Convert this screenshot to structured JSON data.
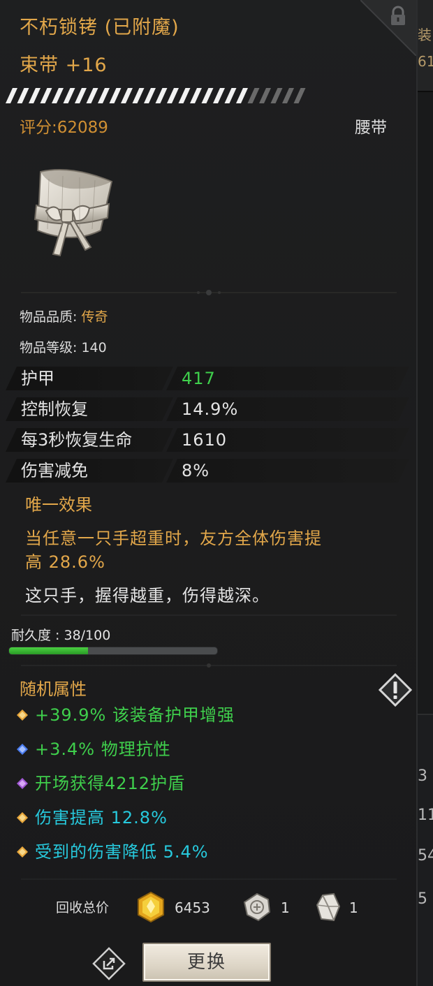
{
  "item": {
    "name": "不朽锁铐 (已附魔)",
    "subtitle": "束带 +16",
    "score": "评分:62089",
    "slot": "腰带",
    "image_icon": "cloth-belt-icon"
  },
  "info": {
    "quality_label": "物品品质: ",
    "quality_value": "传奇",
    "level_label": "物品等级: 140"
  },
  "stats": [
    {
      "name": "护甲",
      "value": "417",
      "color": "#3fcf4c"
    },
    {
      "name": "控制恢复",
      "value": "14.9%",
      "color": "#e4e4e4"
    },
    {
      "name": "每3秒恢复生命",
      "value": "1610",
      "color": "#e4e4e4"
    },
    {
      "name": "伤害减免",
      "value": "8%",
      "color": "#e4e4e4"
    }
  ],
  "unique": {
    "header": "唯一效果",
    "effect_line1": "当任意一只手超重时，友方全体伤害提",
    "effect_line2": "高 28.6%",
    "flavor": "这只手，握得越重，伤得越深。"
  },
  "durability": {
    "label": "耐久度 : 38/100",
    "current": 38,
    "max": 100
  },
  "random_attributes": {
    "header": "随机属性",
    "items": [
      {
        "text": "+39.9% 该装备护甲增强",
        "color": "#3fcf4c",
        "gem": "orange-gem-icon",
        "gem_color": "#e7a63a"
      },
      {
        "text": "+3.4% 物理抗性",
        "color": "#3fcf4c",
        "gem": "blue-gem-icon",
        "gem_color": "#4a7cf0"
      },
      {
        "text": "开场获得4212护盾",
        "color": "#3fcf4c",
        "gem": "purple-gem-icon",
        "gem_color": "#a35ad6"
      },
      {
        "text": "伤害提高 12.8%",
        "color": "#27c9dd",
        "gem": "orange-gem-icon",
        "gem_color": "#e7a63a"
      },
      {
        "text": "受到的伤害降低 5.4%",
        "color": "#27c9dd",
        "gem": "orange-gem-icon",
        "gem_color": "#e7a63a"
      }
    ]
  },
  "salvage": {
    "label": "回收总价",
    "gold_amount": "6453",
    "gold_icon": "gold-crystal-icon",
    "stone_amount": "1",
    "stone_icon": "stone-rune-icon",
    "shard_amount": "1",
    "shard_icon": "crystal-shard-icon"
  },
  "actions": {
    "share_icon": "share-icon",
    "replace_label": "更换"
  },
  "side_panel_fragments": [
    "装",
    "61",
    "3",
    "11",
    "54",
    "5"
  ],
  "colors": {
    "gold_text": "#e2a74a",
    "green_text": "#3fcf4c",
    "cyan_text": "#27c9dd",
    "panel_bg": "#1c1c1d"
  }
}
